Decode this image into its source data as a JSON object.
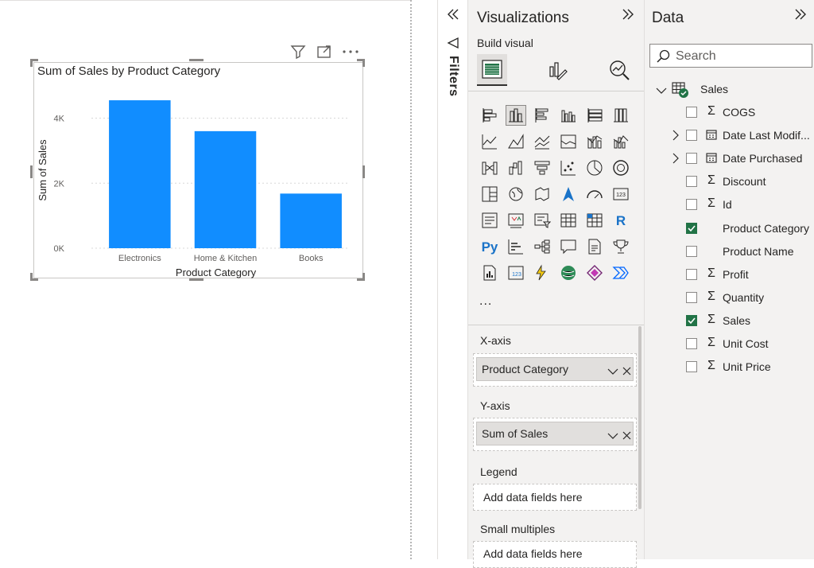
{
  "canvas": {
    "chart_title": "Sum of Sales by Product Category"
  },
  "chart_data": {
    "type": "bar",
    "title": "Sum of Sales by Product Category",
    "categories": [
      "Electronics",
      "Home & Kitchen",
      "Books"
    ],
    "values": [
      4550,
      3600,
      1680
    ],
    "xlabel": "Product Category",
    "ylabel": "Sum of Sales",
    "yticks": [
      "0K",
      "2K",
      "4K"
    ],
    "ytick_values": [
      0,
      2000,
      4000
    ],
    "ylim": [
      0,
      4600
    ],
    "grid": true,
    "bar_color": "#118DFF"
  },
  "filters": {
    "label": "Filters"
  },
  "visualizations": {
    "title": "Visualizations",
    "build_label": "Build visual",
    "more": "...",
    "wells": [
      {
        "title": "X-axis",
        "field": "Product Category"
      },
      {
        "title": "Y-axis",
        "field": "Sum of Sales"
      },
      {
        "title": "Legend",
        "placeholder": "Add data fields here"
      },
      {
        "title": "Small multiples",
        "placeholder": "Add data fields here"
      }
    ]
  },
  "data_pane": {
    "title": "Data",
    "search_placeholder": "Search",
    "table": "Sales",
    "fields": [
      {
        "label": "COGS",
        "type": "sigma",
        "checked": false,
        "expandable": false
      },
      {
        "label": "Date Last Modif...",
        "type": "calendar",
        "checked": false,
        "expandable": true
      },
      {
        "label": "Date Purchased",
        "type": "calendar",
        "checked": false,
        "expandable": true
      },
      {
        "label": "Discount",
        "type": "sigma",
        "checked": false,
        "expandable": false
      },
      {
        "label": "Id",
        "type": "sigma",
        "checked": false,
        "expandable": false
      },
      {
        "label": "Product Category",
        "type": "none",
        "checked": true,
        "expandable": false
      },
      {
        "label": "Product Name",
        "type": "none",
        "checked": false,
        "expandable": false
      },
      {
        "label": "Profit",
        "type": "sigma",
        "checked": false,
        "expandable": false
      },
      {
        "label": "Quantity",
        "type": "sigma",
        "checked": false,
        "expandable": false
      },
      {
        "label": "Sales",
        "type": "sigma",
        "checked": true,
        "expandable": false
      },
      {
        "label": "Unit Cost",
        "type": "sigma",
        "checked": false,
        "expandable": false
      },
      {
        "label": "Unit Price",
        "type": "sigma",
        "checked": false,
        "expandable": false
      }
    ]
  },
  "colors": {
    "accent": "#118DFF",
    "check": "#217346",
    "pane_bg": "#F3F2F1"
  }
}
